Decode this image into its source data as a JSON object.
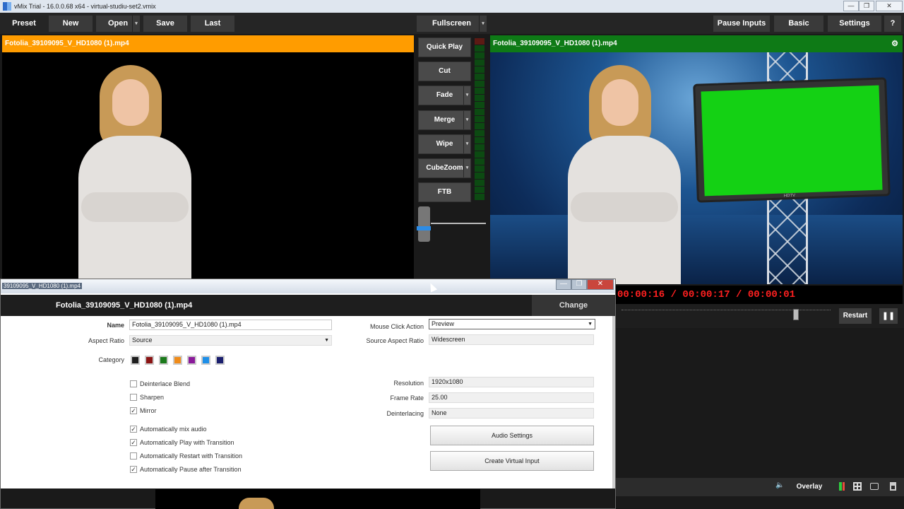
{
  "window": {
    "title": "vMix Trial - 16.0.0.68 x64 - virtual-studiu-set2.vmix",
    "min": "—",
    "max": "❐",
    "close": "✕"
  },
  "toolbar": {
    "preset": "Preset",
    "new": "New",
    "open": "Open",
    "save": "Save",
    "last": "Last",
    "fullscreen": "Fullscreen",
    "pause_inputs": "Pause Inputs",
    "basic": "Basic",
    "settings": "Settings",
    "help": "?"
  },
  "preview": {
    "title": "Fotolia_39109095_V_HD1080 (1).mp4"
  },
  "output": {
    "title": "Fotolia_39109095_V_HD1080 (1).mp4",
    "gear": "⚙",
    "screen_brand": "HDTV"
  },
  "transitions": [
    {
      "label": "Quick Play",
      "dropdown": false
    },
    {
      "label": "Cut",
      "dropdown": false
    },
    {
      "label": "Fade",
      "dropdown": true
    },
    {
      "label": "Merge",
      "dropdown": true
    },
    {
      "label": "Wipe",
      "dropdown": true
    },
    {
      "label": "CubeZoom",
      "dropdown": true
    },
    {
      "label": "FTB",
      "dropdown": false
    }
  ],
  "playback": {
    "timecode": "00:00:16  /  00:00:17  /  00:00:01",
    "restart": "Restart",
    "pause": "❚❚"
  },
  "bottom": {
    "overlay": "Overlay"
  },
  "dialog": {
    "title_tab": "39109095_V_HD1080 (1).mp4",
    "header_name": "Fotolia_39109095_V_HD1080 (1).mp4",
    "change": "Change",
    "name_label": "Name",
    "name_value": "Fotolia_39109095_V_HD1080 (1).mp4",
    "aspect_label": "Aspect Ratio",
    "aspect_value": "Source",
    "category_label": "Category",
    "category_colors": [
      "#1e1e1e",
      "#8b1414",
      "#1b7a1b",
      "#f08c1a",
      "#8a1a9a",
      "#1e8fe8",
      "#1a1f6e"
    ],
    "mouse_click_label": "Mouse Click Action",
    "mouse_click_value": "Preview",
    "source_aspect_label": "Source Aspect Ratio",
    "source_aspect_value": "Widescreen",
    "resolution_label": "Resolution",
    "resolution_value": "1920x1080",
    "frame_rate_label": "Frame Rate",
    "frame_rate_value": "25.00",
    "deinterlacing_label": "Deinterlacing",
    "deinterlacing_value": "None",
    "checkboxes": [
      {
        "label": "Deinterlace Blend",
        "checked": false
      },
      {
        "label": "Sharpen",
        "checked": false
      },
      {
        "label": "Mirror",
        "checked": true
      },
      {
        "label": "Automatically mix audio",
        "checked": true
      },
      {
        "label": "Automatically Play with Transition",
        "checked": true
      },
      {
        "label": "Automatically Restart with Transition",
        "checked": false
      },
      {
        "label": "Automatically Pause after Transition",
        "checked": true
      }
    ],
    "audio_settings": "Audio Settings",
    "create_virtual_input": "Create Virtual Input",
    "check_mark": "✓",
    "dropdown_arrow": "▼"
  }
}
